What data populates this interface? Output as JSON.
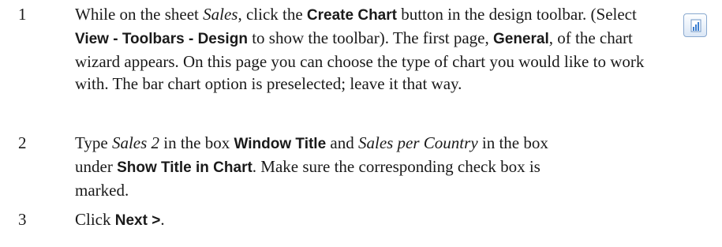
{
  "steps": [
    {
      "number": "1",
      "parts": [
        "While on the sheet ",
        "Sales",
        ", click the ",
        "Create Chart",
        " button in the design toolbar. (Select ",
        "View",
        " - ",
        "Toolbars",
        " - ",
        "Design",
        " to show the toolbar). The first page, ",
        "General",
        ", of the chart wizard appears. On this page you can choose the type of chart you would like to work with. The bar chart option is preselected; leave it that way."
      ]
    },
    {
      "number": "2",
      "parts": [
        "Type ",
        "Sales 2",
        " in the box ",
        "Window Title",
        " and ",
        "Sales per Country",
        " in the box under ",
        "Show Title in Chart",
        ". Make sure the corresponding check box is marked."
      ]
    },
    {
      "number": "3",
      "parts": [
        "Click ",
        "Next >",
        "."
      ]
    }
  ],
  "icons": {
    "create_chart": "bar-chart-icon",
    "accent": "#3d7fd1"
  }
}
